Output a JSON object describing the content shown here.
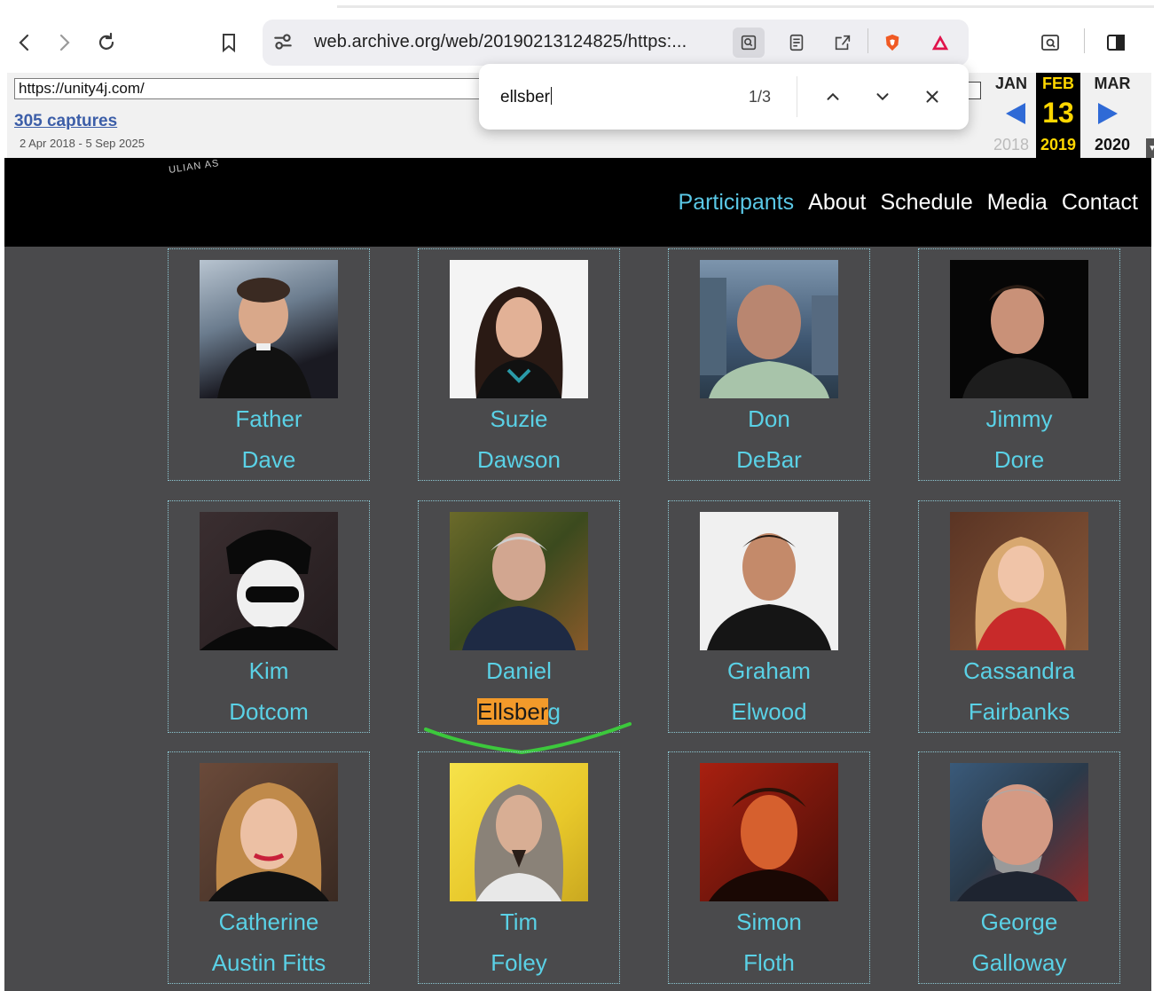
{
  "browser": {
    "url": "web.archive.org/web/20190213124825/https:..."
  },
  "wayback": {
    "input_url": "https://unity4j.com/",
    "captures": "305 captures",
    "range": "2 Apr 2018 - 5 Sep 2025",
    "prev_month": "JAN",
    "cur_month": "FEB",
    "next_month": "MAR",
    "day": "13",
    "prev_year": "2018",
    "cur_year": "2019",
    "next_year": "2020"
  },
  "find": {
    "query": "ellsber",
    "count": "1/3"
  },
  "logo_text": "ULIAN AS",
  "nav": [
    "Participants",
    "About",
    "Schedule",
    "Media",
    "Contact"
  ],
  "participants": [
    {
      "first": "Father",
      "last": "Dave"
    },
    {
      "first": "Suzie",
      "last": "Dawson"
    },
    {
      "first": "Don",
      "last": "DeBar"
    },
    {
      "first": "Jimmy",
      "last": "Dore"
    },
    {
      "first": "Kim",
      "last": "Dotcom"
    },
    {
      "first": "Daniel",
      "last_highlight": "Ellsber",
      "last_rest": "g"
    },
    {
      "first": "Graham",
      "last": "Elwood"
    },
    {
      "first": "Cassandra",
      "last": "Fairbanks"
    },
    {
      "first": "Catherine",
      "last": "Austin Fitts"
    },
    {
      "first": "Tim",
      "last": "Foley"
    },
    {
      "first": "Simon",
      "last": "Floth"
    },
    {
      "first": "George",
      "last": "Galloway"
    }
  ],
  "colors": {
    "link": "#5ad1e6",
    "highlight": "#f39a2a",
    "annotation": "#3cc83c"
  }
}
